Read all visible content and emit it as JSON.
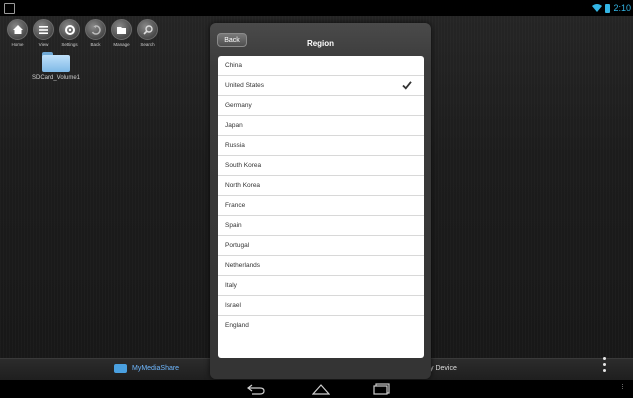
{
  "status_bar": {
    "time": "2:10"
  },
  "toolbar": {
    "items": [
      {
        "label": "Home",
        "icon": "home-icon"
      },
      {
        "label": "View",
        "icon": "list-icon"
      },
      {
        "label": "Settings",
        "icon": "settings-icon"
      },
      {
        "label": "Back",
        "icon": "back-icon"
      },
      {
        "label": "Manage",
        "icon": "folder-open-icon"
      },
      {
        "label": "Search",
        "icon": "search-icon"
      }
    ]
  },
  "files": [
    {
      "name": "SDCard_Volume1",
      "icon": "folder-icon"
    }
  ],
  "dialog": {
    "back_label": "Back",
    "title": "Region",
    "selected": "United States",
    "regions": [
      "China",
      "United States",
      "Germany",
      "Japan",
      "Russia",
      "South Korea",
      "North Korea",
      "France",
      "Spain",
      "Portugal",
      "Netherlands",
      "Italy",
      "Israel",
      "England"
    ]
  },
  "bottom_tabs": {
    "mymedia_label": "MyMediaShare",
    "device_label": "y Device"
  },
  "colors": {
    "accent": "#33b5e5",
    "tab_active": "#6fb8ff",
    "check": "#333333"
  }
}
